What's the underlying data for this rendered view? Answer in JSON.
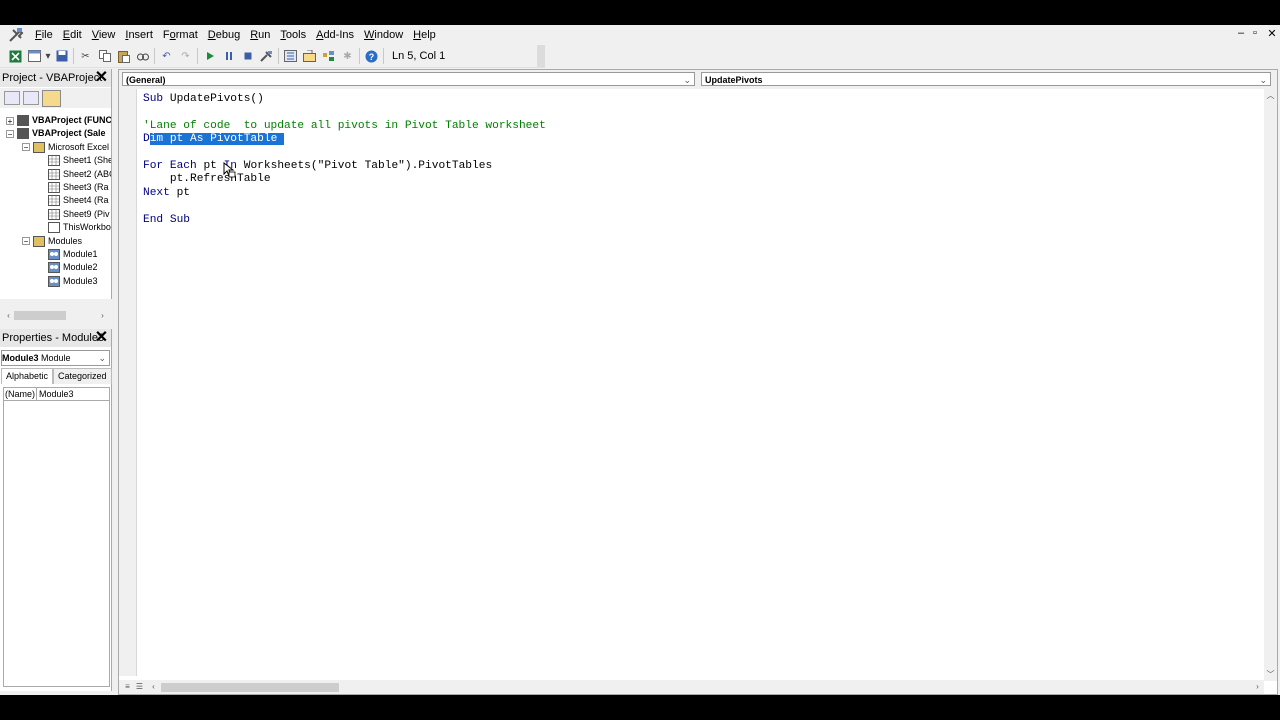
{
  "menu": {
    "items": [
      {
        "label": "File",
        "ul": "F"
      },
      {
        "label": "Edit",
        "ul": "E"
      },
      {
        "label": "View",
        "ul": "V"
      },
      {
        "label": "Insert",
        "ul": "I"
      },
      {
        "label": "Format",
        "ul": "o"
      },
      {
        "label": "Debug",
        "ul": "D"
      },
      {
        "label": "Run",
        "ul": "R"
      },
      {
        "label": "Tools",
        "ul": "T"
      },
      {
        "label": "Add-Ins",
        "ul": "A"
      },
      {
        "label": "Window",
        "ul": "W"
      },
      {
        "label": "Help",
        "ul": "H"
      }
    ],
    "window_controls": [
      "–",
      "▫",
      "✕"
    ]
  },
  "toolbar": {
    "status": "Ln 5, Col 1",
    "icons": [
      "excel-view-icon",
      "insert-module-icon",
      "save-icon",
      "cut-icon",
      "copy-icon",
      "paste-icon",
      "find-icon",
      "undo-icon",
      "redo-icon",
      "run-icon",
      "break-icon",
      "reset-icon",
      "design-mode-icon",
      "project-explorer-icon",
      "properties-window-icon",
      "object-browser-icon",
      "toolbox-icon",
      "help-icon"
    ]
  },
  "project": {
    "title": "Project - VBAProject",
    "nodes": [
      {
        "label": "VBAProject (FUNC",
        "level": 0,
        "expander": "+",
        "bold": true,
        "icon": "vba-project-icon"
      },
      {
        "label": "VBAProject (Sale",
        "level": 0,
        "expander": "−",
        "bold": true,
        "icon": "vba-project-icon"
      },
      {
        "label": "Microsoft Excel",
        "level": 1,
        "expander": "−",
        "bold": false,
        "icon": "folder-icon"
      },
      {
        "label": "Sheet1 (She",
        "level": 2,
        "expander": "",
        "bold": false,
        "icon": "sheet-icon"
      },
      {
        "label": "Sheet2 (ABC",
        "level": 2,
        "expander": "",
        "bold": false,
        "icon": "sheet-icon"
      },
      {
        "label": "Sheet3 (Ra",
        "level": 2,
        "expander": "",
        "bold": false,
        "icon": "sheet-icon"
      },
      {
        "label": "Sheet4 (Ra",
        "level": 2,
        "expander": "",
        "bold": false,
        "icon": "sheet-icon"
      },
      {
        "label": "Sheet9 (Piv",
        "level": 2,
        "expander": "",
        "bold": false,
        "icon": "sheet-icon"
      },
      {
        "label": "ThisWorkbo",
        "level": 2,
        "expander": "",
        "bold": false,
        "icon": "workbook-icon"
      },
      {
        "label": "Modules",
        "level": 1,
        "expander": "−",
        "bold": false,
        "icon": "folder-icon"
      },
      {
        "label": "Module1",
        "level": 2,
        "expander": "",
        "bold": false,
        "icon": "module-icon"
      },
      {
        "label": "Module2",
        "level": 2,
        "expander": "",
        "bold": false,
        "icon": "module-icon"
      },
      {
        "label": "Module3",
        "level": 2,
        "expander": "",
        "bold": false,
        "icon": "module-icon"
      }
    ]
  },
  "properties": {
    "title": "Properties - Module3",
    "object_name": "Module3",
    "object_type": "Module",
    "tabs": [
      "Alphabetic",
      "Categorized"
    ],
    "rows": [
      {
        "key": "(Name)",
        "value": "Module3"
      }
    ]
  },
  "code_window": {
    "object_dropdown": "(General)",
    "procedure_dropdown": "UpdatePivots",
    "lines": [
      {
        "segments": [
          {
            "t": "Sub ",
            "c": "kw"
          },
          {
            "t": "UpdatePivots()",
            "c": ""
          }
        ]
      },
      {
        "segments": []
      },
      {
        "segments": [
          {
            "t": "'Lane of code  to update all pivots in Pivot Table worksheet",
            "c": "comment"
          }
        ]
      },
      {
        "segments": [
          {
            "t": "D",
            "c": "kw"
          },
          {
            "t": "im pt As PivotTable ",
            "c": "sel"
          }
        ]
      },
      {
        "segments": []
      },
      {
        "segments": [
          {
            "t": "For Each ",
            "c": "kw"
          },
          {
            "t": "pt ",
            "c": ""
          },
          {
            "t": "In ",
            "c": "kw"
          },
          {
            "t": "Worksheets(\"Pivot Table\").PivotTables",
            "c": ""
          }
        ]
      },
      {
        "segments": [
          {
            "t": "    pt.RefreshTable",
            "c": ""
          }
        ]
      },
      {
        "segments": [
          {
            "t": "Next ",
            "c": "kw"
          },
          {
            "t": "pt",
            "c": ""
          }
        ]
      },
      {
        "segments": []
      },
      {
        "segments": [
          {
            "t": "End Sub",
            "c": "kw"
          }
        ]
      }
    ]
  },
  "colors": {
    "keyword": "#00007f",
    "comment": "#007f00",
    "selection": "#1a74d6"
  }
}
